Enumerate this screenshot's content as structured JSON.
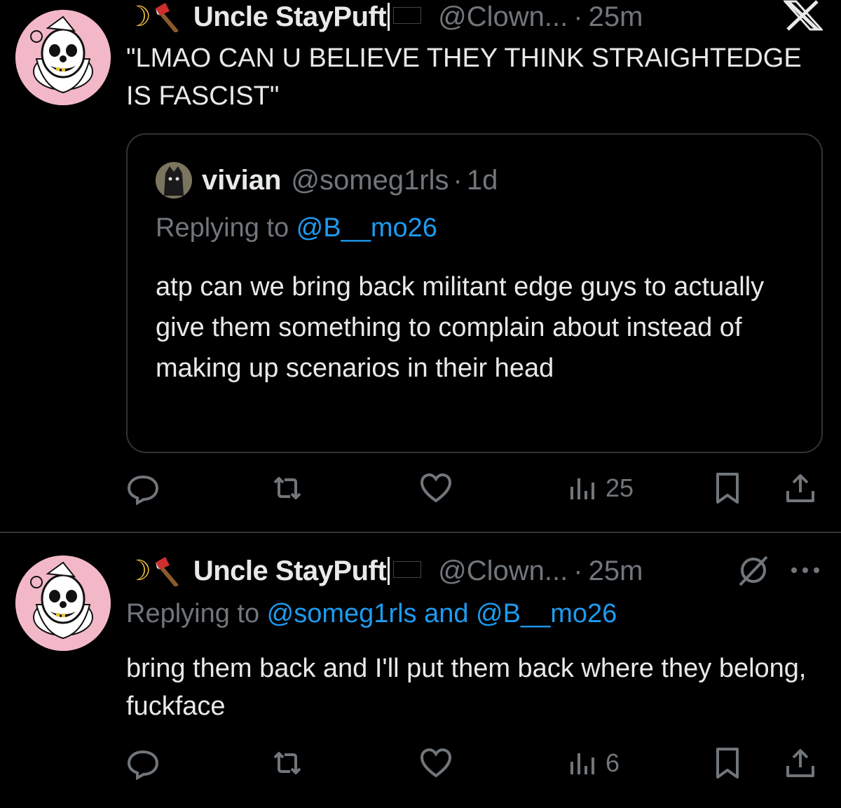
{
  "tweet1": {
    "display_name": "Uncle StayPuft",
    "handle": "@Clown...",
    "separator": "·",
    "time": "25m",
    "text": "\"LMAO CAN U BELIEVE THEY THINK STRAIGHTEDGE IS FASCIST\"",
    "quoted": {
      "display_name": "vivian",
      "handle": "@someg1rls",
      "separator": "·",
      "time": "1d",
      "replying_prefix": "Replying to ",
      "replying_to": "@B__mo26",
      "text": "atp can we bring back militant edge guys to actually give them something to complain about instead of making up scenarios in their head"
    },
    "views": "25"
  },
  "tweet2": {
    "display_name": "Uncle StayPuft",
    "handle": "@Clown...",
    "separator": "·",
    "time": "25m",
    "replying_prefix": "Replying to ",
    "replying_to": "@someg1rls and @B__mo26",
    "text": "bring them back and I'll put them back where they belong, fuckface",
    "views": "6"
  },
  "icons": {
    "moon": "crescent-moon-emoji",
    "axe": "axe-emoji",
    "flag": "black-flag-emoji",
    "close": "x-logo-icon",
    "reply": "reply-icon",
    "retweet": "retweet-icon",
    "like": "heart-icon",
    "views": "views-icon",
    "bookmark": "bookmark-icon",
    "share": "share-icon",
    "grok": "grok-icon",
    "more": "more-icon"
  },
  "colors": {
    "background": "#000000",
    "text": "#e7e9ea",
    "muted": "#71767b",
    "link": "#1d9bf0",
    "border": "#2f3336",
    "avatar_bg": "#f3b8c8"
  }
}
